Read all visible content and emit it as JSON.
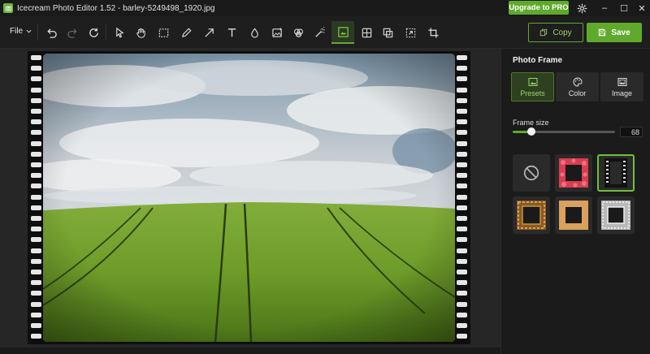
{
  "window": {
    "title": "Icecream Photo Editor 1.52 - barley-5249498_1920.jpg",
    "upgrade_label": "Upgrade to PRO",
    "minimize": "–",
    "maximize": "☐",
    "close": "✕"
  },
  "toolbar": {
    "file_label": "File",
    "copy_label": "Copy",
    "save_label": "Save",
    "accent_color": "#5faa2c"
  },
  "panel": {
    "title": "Photo Frame",
    "tabs": [
      {
        "label": "Presets",
        "icon": "image-icon",
        "active": true
      },
      {
        "label": "Color",
        "icon": "palette-icon",
        "active": false
      },
      {
        "label": "Image",
        "icon": "frame-image-icon",
        "active": false
      }
    ],
    "frame_size_label": "Frame size",
    "frame_size_value": "68",
    "frame_size_fraction": 0.18,
    "presets": [
      {
        "name": "no-frame",
        "selected": false
      },
      {
        "name": "red-floral",
        "selected": false
      },
      {
        "name": "film-strip",
        "selected": true
      },
      {
        "name": "ornate-gold",
        "selected": false
      },
      {
        "name": "wood",
        "selected": false
      },
      {
        "name": "silver",
        "selected": false
      }
    ]
  }
}
